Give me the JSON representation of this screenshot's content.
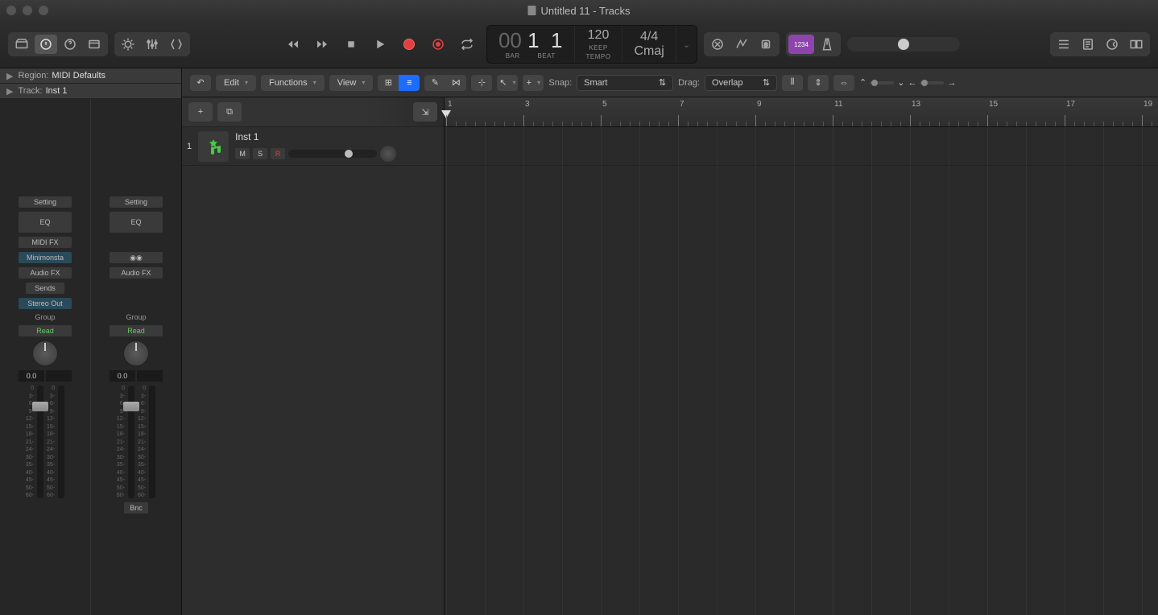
{
  "window": {
    "title": "Untitled 11 - Tracks"
  },
  "lcd": {
    "pos1": "00",
    "pos2": "1",
    "pos3": "1",
    "bar": "BAR",
    "beat": "BEAT",
    "tempo": "120",
    "tempo_label": "TEMPO",
    "keep": "KEEP",
    "sig": "4/4",
    "key": "Cmaj"
  },
  "inspector": {
    "region_label": "Region:",
    "region_value": "MIDI Defaults",
    "track_label": "Track:",
    "track_value": "Inst 1"
  },
  "channel": {
    "setting": "Setting",
    "eq": "EQ",
    "midifx": "MIDI FX",
    "inst": "Minimonsta",
    "audiofx": "Audio FX",
    "sends": "Sends",
    "output": "Stereo Out",
    "group": "Group",
    "read": "Read",
    "pan": "0.0",
    "bnc": "Bnc",
    "scale": [
      "0",
      "3-",
      "6-",
      "9-",
      "12-",
      "15-",
      "18-",
      "21-",
      "24-",
      "30-",
      "35-",
      "40-",
      "45-",
      "50-",
      "60-"
    ]
  },
  "trackmenu": {
    "edit": "Edit",
    "functions": "Functions",
    "view": "View",
    "snap_label": "Snap:",
    "snap_value": "Smart",
    "drag_label": "Drag:",
    "drag_value": "Overlap"
  },
  "track": {
    "num": "1",
    "name": "Inst 1",
    "m": "M",
    "s": "S",
    "r": "R"
  },
  "ruler": [
    1,
    3,
    5,
    7,
    9,
    11,
    13,
    15,
    17,
    19
  ],
  "purple_badge": "1234"
}
